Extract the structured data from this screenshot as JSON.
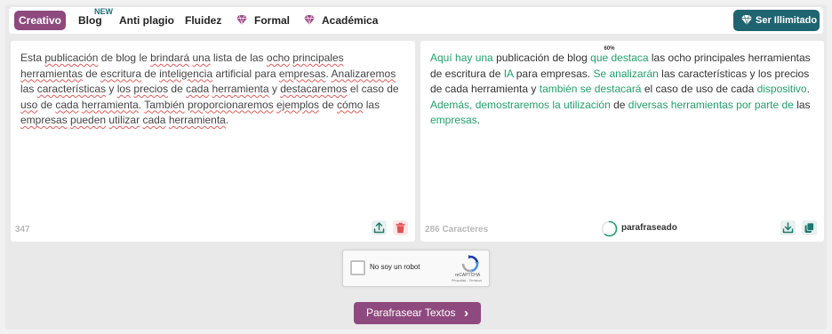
{
  "modes": {
    "creativo": "Creativo",
    "blog": "Blog",
    "blog_badge": "NEW",
    "anti_plagio": "Anti plagio",
    "fluidez": "Fluidez",
    "formal": "Formal",
    "academica": "Académica"
  },
  "premium_label": "Ser Illimitado",
  "input_panel": {
    "segments": [
      {
        "t": "Esta ",
        "u": false
      },
      {
        "t": "publicación",
        "u": true
      },
      {
        "t": " de blog le ",
        "u": false
      },
      {
        "t": "brindará",
        "u": true
      },
      {
        "t": " ",
        "u": false
      },
      {
        "t": "una",
        "u": true
      },
      {
        "t": " lista de las ",
        "u": false
      },
      {
        "t": "ocho",
        "u": true
      },
      {
        "t": " ",
        "u": false
      },
      {
        "t": "principales",
        "u": true
      },
      {
        "t": " ",
        "u": false
      },
      {
        "t": "herramientas",
        "u": true
      },
      {
        "t": " de ",
        "u": false
      },
      {
        "t": "escritura",
        "u": true
      },
      {
        "t": " de ",
        "u": false
      },
      {
        "t": "inteligencia",
        "u": true
      },
      {
        "t": " artificial para ",
        "u": false
      },
      {
        "t": "empresas",
        "u": true
      },
      {
        "t": ". ",
        "u": false
      },
      {
        "t": "Analizaremos",
        "u": true
      },
      {
        "t": " las ",
        "u": false
      },
      {
        "t": "características",
        "u": true
      },
      {
        "t": " y ",
        "u": false
      },
      {
        "t": "los",
        "u": true
      },
      {
        "t": " ",
        "u": false
      },
      {
        "t": "precios",
        "u": true
      },
      {
        "t": " de ",
        "u": false
      },
      {
        "t": "cada",
        "u": true
      },
      {
        "t": " ",
        "u": false
      },
      {
        "t": "herramienta",
        "u": true
      },
      {
        "t": " y ",
        "u": false
      },
      {
        "t": "destacaremos",
        "u": true
      },
      {
        "t": " el caso de ",
        "u": false
      },
      {
        "t": "uso",
        "u": true
      },
      {
        "t": " de ",
        "u": false
      },
      {
        "t": "cada",
        "u": true
      },
      {
        "t": " ",
        "u": false
      },
      {
        "t": "herramienta",
        "u": true
      },
      {
        "t": ". ",
        "u": false
      },
      {
        "t": "También",
        "u": true
      },
      {
        "t": " ",
        "u": false
      },
      {
        "t": "proporcionaremos",
        "u": true
      },
      {
        "t": " ",
        "u": false
      },
      {
        "t": "ejemplos",
        "u": true
      },
      {
        "t": " de ",
        "u": false
      },
      {
        "t": "cómo",
        "u": true
      },
      {
        "t": " las ",
        "u": false
      },
      {
        "t": "empresas",
        "u": true
      },
      {
        "t": " ",
        "u": false
      },
      {
        "t": "pueden",
        "u": true
      },
      {
        "t": " ",
        "u": false
      },
      {
        "t": "utilizar",
        "u": true
      },
      {
        "t": " ",
        "u": false
      },
      {
        "t": "cada",
        "u": true
      },
      {
        "t": " ",
        "u": false
      },
      {
        "t": "herramienta",
        "u": true
      },
      {
        "t": ".",
        "u": false
      }
    ],
    "count": "347"
  },
  "output_panel": {
    "segments": [
      {
        "t": "Aquí hay una",
        "g": true
      },
      {
        "t": " publicación de blog ",
        "g": false
      },
      {
        "t": "que destaca",
        "g": true
      },
      {
        "t": " las ocho principales herramientas de escritura de ",
        "g": false
      },
      {
        "t": "IA",
        "g": true
      },
      {
        "t": " para empresas. ",
        "g": false
      },
      {
        "t": "Se analizarán",
        "g": true
      },
      {
        "t": " las características y los precios de cada herramienta y ",
        "g": false
      },
      {
        "t": "también se destacará",
        "g": true
      },
      {
        "t": " el caso de uso de cada ",
        "g": false
      },
      {
        "t": "dispositivo",
        "g": true
      },
      {
        "t": ". ",
        "g": false
      },
      {
        "t": "Además, demostraremos la utilización",
        "g": true
      },
      {
        "t": " de ",
        "g": false
      },
      {
        "t": "diversas herramientas por parte de",
        "g": true
      },
      {
        "t": " las ",
        "g": false
      },
      {
        "t": "empresas",
        "g": true
      },
      {
        "t": ".",
        "g": false
      }
    ],
    "count": "286 Caracteres",
    "progress_pct": "60%",
    "progress_value": 0.6,
    "progress_label": "parafraseado"
  },
  "captcha": {
    "label": "No soy un robot",
    "brand": "reCAPTCHA",
    "terms": "Privacidad - Términos"
  },
  "submit_label": "Parafrasear Textos",
  "colors": {
    "accent": "#8e4a7e",
    "premium": "#1f6470",
    "changed_text": "#21a06a",
    "progress": "#21a06a"
  }
}
